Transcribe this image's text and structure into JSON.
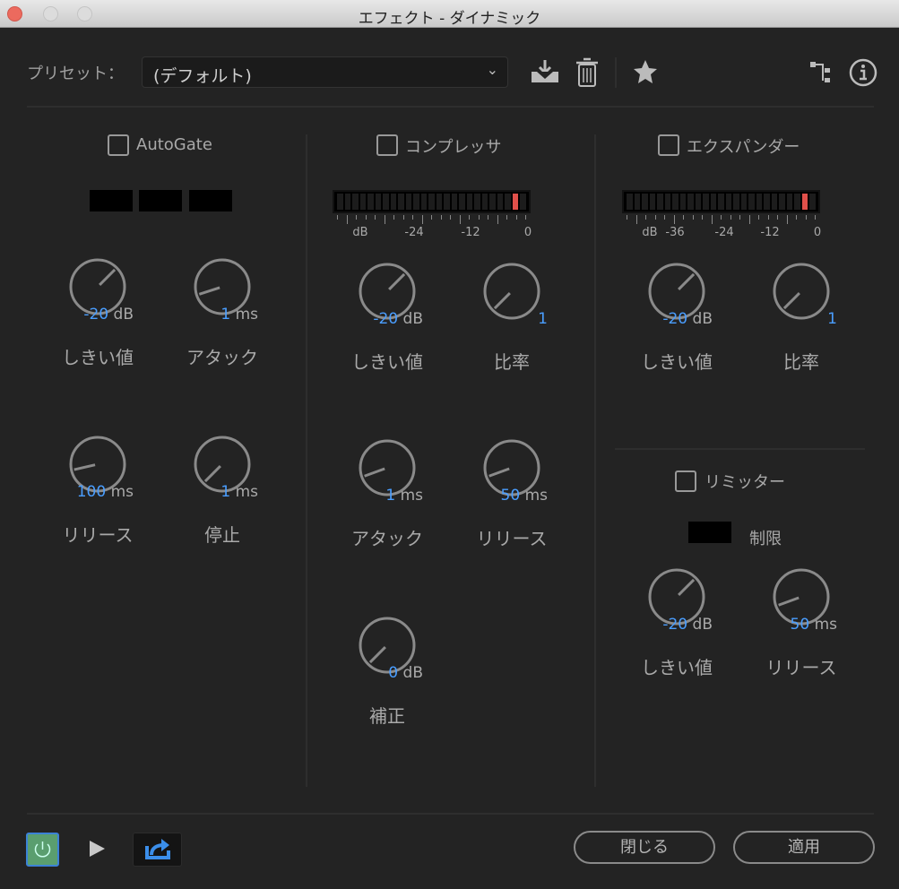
{
  "window": {
    "title": "エフェクト - ダイナミック"
  },
  "preset": {
    "label": "プリセット：",
    "value": "(デフォルト)"
  },
  "toolbar": {
    "icons": [
      "download-icon",
      "trash-icon",
      "star-icon",
      "routing-icon",
      "info-icon"
    ]
  },
  "autogate": {
    "label": "AutoGate",
    "checked": false,
    "knobs": [
      {
        "value": "-20",
        "unit": "dB",
        "label": "しきい値"
      },
      {
        "value": "1",
        "unit": "ms",
        "label": "アタック"
      },
      {
        "value": "100",
        "unit": "ms",
        "label": "リリース"
      },
      {
        "value": "1",
        "unit": "ms",
        "label": "停止"
      }
    ]
  },
  "compressor": {
    "label": "コンプレッサ",
    "checked": false,
    "meter_ticks": [
      "dB",
      "-24",
      "-12",
      "0"
    ],
    "knobs": [
      {
        "value": "-20",
        "unit": "dB",
        "label": "しきい値"
      },
      {
        "value": "1",
        "unit": "",
        "label": "比率"
      },
      {
        "value": "1",
        "unit": "ms",
        "label": "アタック"
      },
      {
        "value": "50",
        "unit": "ms",
        "label": "リリース"
      },
      {
        "value": "0",
        "unit": "dB",
        "label": "補正"
      }
    ]
  },
  "expander": {
    "label": "エクスパンダー",
    "checked": false,
    "meter_ticks": [
      "dB",
      "-36",
      "-24",
      "-12",
      "0"
    ],
    "knobs": [
      {
        "value": "-20",
        "unit": "dB",
        "label": "しきい値"
      },
      {
        "value": "1",
        "unit": "",
        "label": "比率"
      }
    ]
  },
  "limiter": {
    "label": "リミッター",
    "checked": false,
    "limit_label": "制限",
    "knobs": [
      {
        "value": "-20",
        "unit": "dB",
        "label": "しきい値"
      },
      {
        "value": "50",
        "unit": "ms",
        "label": "リリース"
      }
    ]
  },
  "footer": {
    "close": "閉じる",
    "apply": "適用"
  },
  "colors": {
    "accent": "#4a9eff",
    "power": "#5a9e6f",
    "meter_peak": "#e0504a"
  }
}
